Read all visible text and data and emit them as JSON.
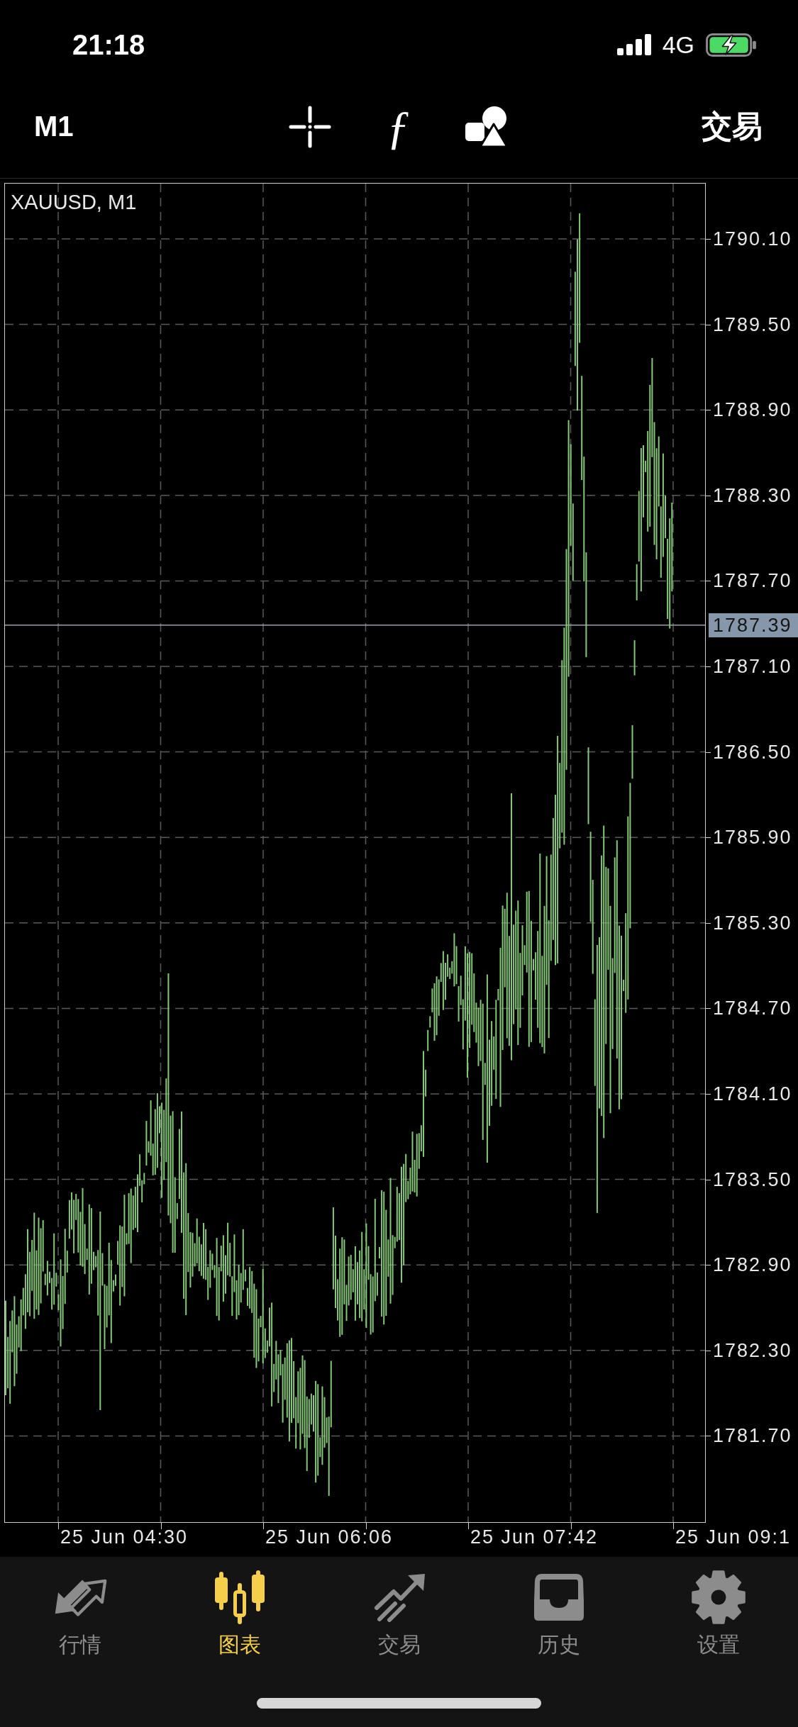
{
  "status_bar": {
    "time": "21:18",
    "network": "4G"
  },
  "toolbar": {
    "timeframe": "M1",
    "function_symbol": "ƒ",
    "trade_button": "交易"
  },
  "chart": {
    "symbol_label": "XAUUSD, M1",
    "price_ticks": [
      "1790.10",
      "1789.50",
      "1788.90",
      "1788.30",
      "1787.70",
      "1787.10",
      "1786.50",
      "1785.90",
      "1785.30",
      "1784.70",
      "1784.10",
      "1783.50",
      "1782.90",
      "1782.30",
      "1781.70"
    ],
    "current_price": "1787.39",
    "time_ticks": [
      "25 Jun 04:30",
      "25 Jun 06:06",
      "25 Jun 07:42",
      "25 Jun 09:1"
    ]
  },
  "tab_bar": {
    "tabs": [
      {
        "label": "行情",
        "selected": false
      },
      {
        "label": "图表",
        "selected": true
      },
      {
        "label": "交易",
        "selected": false
      },
      {
        "label": "历史",
        "selected": false
      },
      {
        "label": "设置",
        "selected": false
      }
    ]
  }
}
